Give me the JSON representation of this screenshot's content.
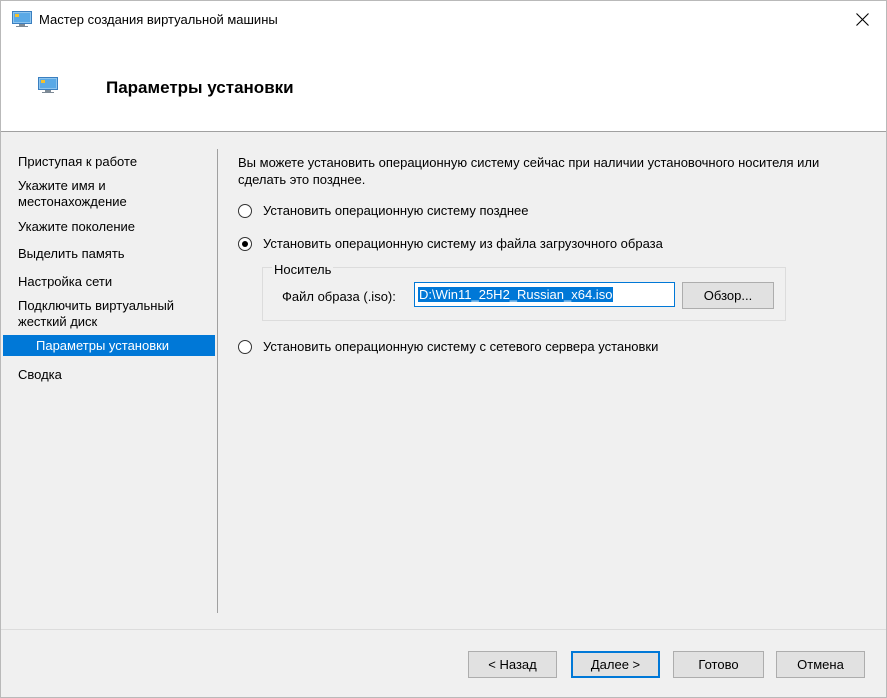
{
  "window": {
    "title": "Мастер создания виртуальной машины",
    "accent_color": "#0078d7"
  },
  "header": {
    "title": "Параметры установки"
  },
  "steps": [
    {
      "label": "Приступая к работе"
    },
    {
      "label": "Укажите имя и местонахождение"
    },
    {
      "label": "Укажите поколение"
    },
    {
      "label": "Выделить память"
    },
    {
      "label": "Настройка сети"
    },
    {
      "label": "Подключить виртуальный жесткий диск"
    },
    {
      "label": "Параметры установки",
      "active": true
    },
    {
      "label": "Сводка"
    }
  ],
  "main": {
    "intro": "Вы можете установить операционную систему сейчас при наличии установочного носителя или сделать это позднее.",
    "options": [
      {
        "label": "Установить операционную систему позднее",
        "selected": false
      },
      {
        "label": "Установить операционную систему из файла загрузочного образа",
        "selected": true
      },
      {
        "label": "Установить операционную систему с сетевого сервера установки",
        "selected": false
      }
    ],
    "media_group": {
      "title": "Носитель",
      "image_file_label": "Файл образа (.iso):",
      "image_file_value": "D:\\Win11_25H2_Russian_x64.iso",
      "browse_label": "Обзор..."
    }
  },
  "footer": {
    "back_label": "< Назад",
    "next_label": "Далее >",
    "finish_label": "Готово",
    "cancel_label": "Отмена"
  }
}
